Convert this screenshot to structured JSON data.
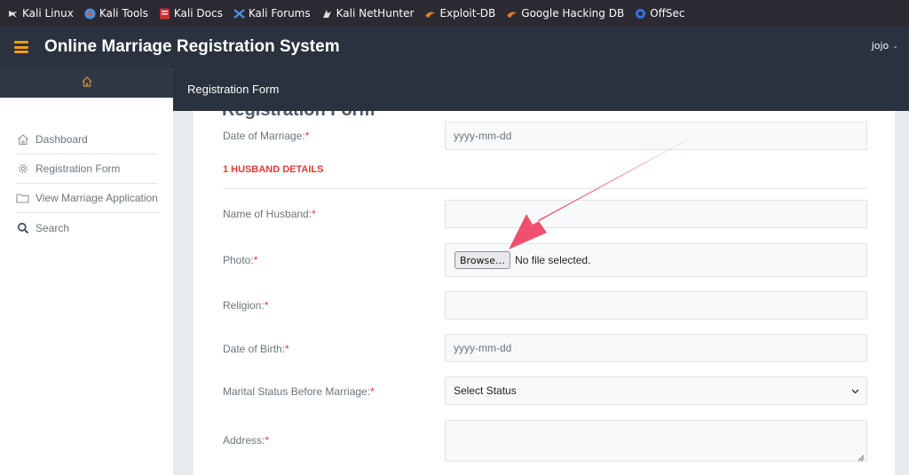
{
  "bookmarks": [
    {
      "label": "Kali Linux",
      "icon": "kali-dragon-icon",
      "color": "#dddddd"
    },
    {
      "label": "Kali Tools",
      "icon": "kali-tools-icon",
      "color": "#e74c3c"
    },
    {
      "label": "Kali Docs",
      "icon": "kali-docs-icon",
      "color": "#d32f2f"
    },
    {
      "label": "Kali Forums",
      "icon": "kali-forums-icon",
      "color": "#4a90e2"
    },
    {
      "label": "Kali NetHunter",
      "icon": "kali-nethunter-icon",
      "color": "#dddddd"
    },
    {
      "label": "Exploit-DB",
      "icon": "exploit-db-icon",
      "color": "#e67e22"
    },
    {
      "label": "Google Hacking DB",
      "icon": "ghdb-icon",
      "color": "#e67e22"
    },
    {
      "label": "OffSec",
      "icon": "offsec-icon",
      "color": "#3b6de0"
    }
  ],
  "header": {
    "title": "Online Marriage Registration System",
    "user": "jojo",
    "accent": "#f39c12"
  },
  "sidebar": {
    "items": [
      {
        "label": "Dashboard",
        "icon": "home-icon"
      },
      {
        "label": "Registration Form",
        "icon": "gear-icon"
      },
      {
        "label": "View Marriage Application",
        "icon": "folder-icon"
      },
      {
        "label": "Search",
        "icon": "search-icon"
      }
    ]
  },
  "page": {
    "breadcrumb": "Registration Form"
  },
  "form": {
    "date_of_marriage": {
      "label": "Date of Marriage:",
      "placeholder": "yyyy-mm-dd"
    },
    "section_title": "1 HUSBAND DETAILS",
    "name_of_husband": {
      "label": "Name of Husband:",
      "value": ""
    },
    "photo": {
      "label": "Photo:",
      "button": "Browse…",
      "status": "No file selected."
    },
    "religion": {
      "label": "Religion:",
      "value": ""
    },
    "date_of_birth": {
      "label": "Date of Birth:",
      "placeholder": "yyyy-mm-dd"
    },
    "marital_status": {
      "label": "Marital Status Before Marriage:",
      "selected": "Select Status"
    },
    "address": {
      "label": "Address:",
      "value": ""
    },
    "required_marker": "*"
  },
  "annotation": {
    "color": "#f0506e"
  }
}
